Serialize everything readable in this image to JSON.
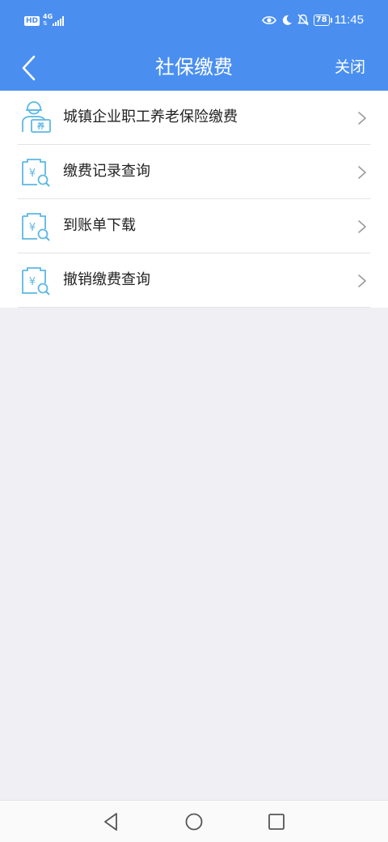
{
  "status_bar": {
    "hd": "HD",
    "network": "4G",
    "battery": "78",
    "time": "11:45"
  },
  "header": {
    "title": "社保缴费",
    "close_label": "关闭"
  },
  "menu": {
    "items": [
      {
        "label": "城镇企业职工养老保险缴费",
        "icon": "pension-worker-icon"
      },
      {
        "label": "缴费记录查询",
        "icon": "payment-search-icon"
      },
      {
        "label": "到账单下载",
        "icon": "payment-search-icon"
      },
      {
        "label": "撤销缴费查询",
        "icon": "payment-search-icon"
      }
    ]
  },
  "colors": {
    "accent": "#4a8ff0",
    "icon": "#5bb8e4",
    "background": "#efeff4"
  }
}
